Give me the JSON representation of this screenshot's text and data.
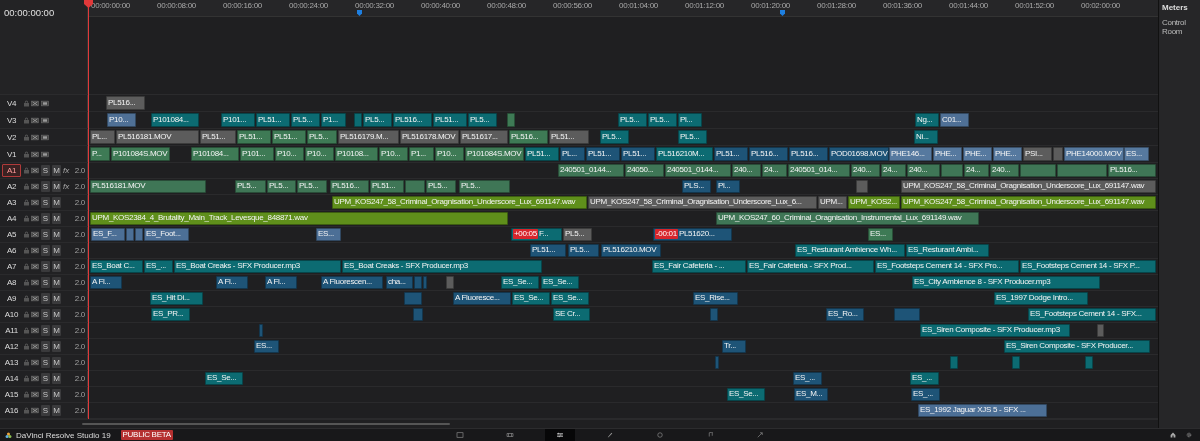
{
  "timecode": "00:00:00:00",
  "ruler": [
    "00:00:00:00",
    "00:00:08:00",
    "00:00:16:00",
    "00:00:24:00",
    "00:00:32:00",
    "00:00:40:00",
    "00:00:48:00",
    "00:00:56:00",
    "00:01:04:00",
    "00:01:12:00",
    "00:01:20:00",
    "00:01:28:00",
    "00:01:36:00",
    "00:01:44:00",
    "00:01:52:00",
    "00:02:00:00"
  ],
  "tracks": [
    {
      "name": "V4",
      "kind": "video",
      "selected": false,
      "clips": [
        {
          "label": "PL516...",
          "color": "#5c5c5c"
        }
      ]
    },
    {
      "name": "V3",
      "kind": "video",
      "selected": false,
      "clips": [
        {
          "label": "P10...",
          "color": "#4f7096"
        },
        {
          "label": "P101084...",
          "color": "#0c6b72"
        },
        {
          "label": "P101...",
          "color": "#0c6b72"
        },
        {
          "label": "PL51...",
          "color": "#0c6b72"
        },
        {
          "label": "PL5...",
          "color": "#0c6b72"
        },
        {
          "label": "P1...",
          "color": "#0c6b72"
        },
        {
          "color": "#0c6b72"
        },
        {
          "label": "PL5...",
          "color": "#0c6b72"
        },
        {
          "label": "PL516...",
          "color": "#0c6b72"
        },
        {
          "label": "PL51...",
          "color": "#0c6b72"
        },
        {
          "label": "PL5...",
          "color": "#0c6b72"
        },
        {
          "color": "#3e7a55"
        },
        {
          "label": "PL5...",
          "color": "#0c6b72"
        },
        {
          "label": "PL5...",
          "color": "#0c6b72"
        },
        {
          "label": "Pl...",
          "color": "#0c6b72"
        },
        {
          "label": "Ng...",
          "color": "#0c6b72"
        },
        {
          "label": "C01...",
          "color": "#4f7096"
        }
      ]
    },
    {
      "name": "V2",
      "kind": "video",
      "selected": false,
      "clips": [
        {
          "label": "PL...",
          "color": "#5c5c5c"
        },
        {
          "label": "PL516181.MOV",
          "color": "#5c5c5c"
        },
        {
          "label": "PL51...",
          "color": "#5c5c5c"
        },
        {
          "label": "PL51...",
          "color": "#3e7a55"
        },
        {
          "label": "PL51...",
          "color": "#3e7a55"
        },
        {
          "label": "PL5...",
          "color": "#3e7a55"
        },
        {
          "label": "PL516179.M...",
          "color": "#5c5c5c"
        },
        {
          "label": "PL516178.MOV",
          "color": "#5c5c5c"
        },
        {
          "label": "PL51617...",
          "color": "#5c5c5c"
        },
        {
          "label": "PL516...",
          "color": "#3e7a55"
        },
        {
          "label": "PL51...",
          "color": "#5c5c5c"
        },
        {
          "label": "PL5...",
          "color": "#0c6b72"
        },
        {
          "label": "PL5...",
          "color": "#0c6b72"
        },
        {
          "label": "Ni...",
          "color": "#0c6b72"
        }
      ]
    },
    {
      "name": "V1",
      "kind": "video",
      "selected": false,
      "clips": [
        {
          "label": "P...",
          "color": "#3e7a55"
        },
        {
          "label": "P101084S.MOV",
          "color": "#3e7a55"
        },
        {
          "label": "P101084...",
          "color": "#3e7a55"
        },
        {
          "label": "P101...",
          "color": "#3e7a55"
        },
        {
          "label": "P10...",
          "color": "#3e7a55"
        },
        {
          "label": "P10...",
          "color": "#3e7a55"
        },
        {
          "label": "P10108...",
          "color": "#3e7a55"
        },
        {
          "label": "P10...",
          "color": "#3e7a55"
        },
        {
          "label": "P1...",
          "color": "#3e7a55"
        },
        {
          "label": "P10...",
          "color": "#3e7a55"
        },
        {
          "label": "P101084S.MOV",
          "color": "#3e7a55"
        },
        {
          "label": "PL51...",
          "color": "#0c6b72"
        },
        {
          "label": "PL...",
          "color": "#1e5477"
        },
        {
          "label": "PL51...",
          "color": "#1e5477"
        },
        {
          "label": "PL51...",
          "color": "#1e5477"
        },
        {
          "label": "PL516210M...",
          "color": "#0c6b72"
        },
        {
          "label": "PL51...",
          "color": "#1e5477"
        },
        {
          "label": "PL516...",
          "color": "#1e5477"
        },
        {
          "label": "PL516...",
          "color": "#1e5477"
        },
        {
          "label": "POD01698.MOV",
          "color": "#1e5477"
        },
        {
          "label": "PHE146...",
          "color": "#56799f"
        },
        {
          "label": "PHE...",
          "color": "#56799f"
        },
        {
          "label": "PHE...",
          "color": "#56799f"
        },
        {
          "label": "PHE...",
          "color": "#56799f"
        },
        {
          "label": "PSI...",
          "color": "#5c5c5c"
        },
        {
          "color": "#5c5c5c"
        },
        {
          "label": "PHE14000.MOV",
          "color": "#56799f"
        },
        {
          "label": "ES...",
          "color": "#56799f"
        }
      ]
    },
    {
      "name": "A1",
      "kind": "audio",
      "selected": true,
      "fx": "fx",
      "solo": "S",
      "mute": "M",
      "format": "2.0",
      "clips": [
        {
          "label": "240501_0144...",
          "color": "#3f7656"
        },
        {
          "label": "24050...",
          "color": "#3f7656"
        },
        {
          "label": "240501_0144...",
          "color": "#3f7656"
        },
        {
          "label": "240...",
          "color": "#3f7656"
        },
        {
          "label": "24...",
          "color": "#3f7656"
        },
        {
          "label": "240501_014...",
          "color": "#3f7656"
        },
        {
          "label": "240...",
          "color": "#3f7656"
        },
        {
          "label": "24...",
          "color": "#3f7656"
        },
        {
          "label": "240...",
          "color": "#3f7656"
        },
        {
          "color": "#3f7656"
        },
        {
          "label": "24...",
          "color": "#3f7656"
        },
        {
          "label": "240...",
          "color": "#3f7656"
        },
        {
          "color": "#3f7656"
        },
        {
          "color": "#3f7656"
        },
        {
          "label": "PL516...",
          "color": "#3f7656"
        }
      ]
    },
    {
      "name": "A2",
      "kind": "audio",
      "selected": false,
      "fx": "fx",
      "solo": "S",
      "mute": "M",
      "format": "2.0",
      "clips": [
        {
          "label": "PL516181.MOV",
          "color": "#3f7656"
        },
        {
          "label": "PL5...",
          "color": "#3f7656"
        },
        {
          "label": "PL5...",
          "color": "#3f7656"
        },
        {
          "label": "PL5...",
          "color": "#3f7656"
        },
        {
          "label": "PL516...",
          "color": "#3f7656"
        },
        {
          "label": "PL51...",
          "color": "#3f7656"
        },
        {
          "color": "#3f7656"
        },
        {
          "label": "PL5...",
          "color": "#3f7656"
        },
        {
          "label": "PL5...",
          "color": "#3f7656"
        },
        {
          "label": "PLS...",
          "color": "#1e5477"
        },
        {
          "label": "Pl...",
          "color": "#1e5477"
        },
        {
          "color": "#5c5c5c"
        },
        {
          "label": "UPM_KOS247_58_Criminal_Oragnisation_Underscore_Lux_691147.wav",
          "color": "#5c5c5c"
        }
      ]
    },
    {
      "name": "A3",
      "kind": "audio",
      "selected": false,
      "solo": "S",
      "mute": "M",
      "format": "2.0",
      "clips": [
        {
          "label": "UPM_KOS247_58_Criminal_Oragnisation_Underscore_Lux_691147.wav",
          "color": "#5f8f1b"
        },
        {
          "label": "UPM_KOS247_58_Criminal_Oragnisation_Underscore_Lux_6...",
          "color": "#5c5c5c"
        },
        {
          "label": "UPM...",
          "color": "#5c5c5c"
        },
        {
          "label": "UPM_KOS2...",
          "color": "#5f8f1b"
        },
        {
          "label": "UPM_KOS247_58_Criminal_Oragnisation_Underscore_Lux_691147.wav",
          "color": "#5f8f1b"
        }
      ]
    },
    {
      "name": "A4",
      "kind": "audio",
      "selected": false,
      "solo": "S",
      "mute": "M",
      "format": "2.0",
      "clips": [
        {
          "label": "UPM_KOS2384_4_Brutality_Main_Track_Levesque_848871.wav",
          "color": "#5f8f1b"
        },
        {
          "label": "UPM_KOS247_60_Criminal_Oragnisation_Instrumental_Lux_691149.wav",
          "color": "#3f7656"
        }
      ]
    },
    {
      "name": "A5",
      "kind": "audio",
      "selected": false,
      "solo": "S",
      "mute": "M",
      "format": "2.0",
      "clips": [
        {
          "label": "ES_F...",
          "color": "#4c6f96"
        },
        {
          "color": "#4c6f96"
        },
        {
          "color": "#4c6f96"
        },
        {
          "label": "ES_Foot...",
          "color": "#4c6f96"
        },
        {
          "label": "ES...",
          "color": "#4c6f96"
        },
        {
          "badge": "+00:05",
          "label": "F...",
          "color": "#0c6b72"
        },
        {
          "label": "PL5...",
          "color": "#5c5c5c"
        },
        {
          "badge": "-00:01",
          "label": "PL51620...",
          "color": "#1e5477"
        },
        {
          "label": "ES...",
          "color": "#3e7a55"
        }
      ]
    },
    {
      "name": "A6",
      "kind": "audio",
      "selected": false,
      "solo": "S",
      "mute": "M",
      "format": "2.0",
      "clips": [
        {
          "label": "PL51...",
          "color": "#1e5477"
        },
        {
          "label": "PL5...",
          "color": "#1e5477"
        },
        {
          "label": "PL516210.MOV",
          "color": "#1e5477"
        },
        {
          "label": "ES_Resturant Ambience Wh...",
          "color": "#0c6b72"
        },
        {
          "label": "ES_Resturant Ambi...",
          "color": "#0c6b72"
        }
      ]
    },
    {
      "name": "A7",
      "kind": "audio",
      "selected": false,
      "solo": "S",
      "mute": "M",
      "format": "2.0",
      "clips": [
        {
          "label": "ES_Boat C...",
          "color": "#0c6b72"
        },
        {
          "label": "ES_...",
          "color": "#0c6b72"
        },
        {
          "label": "ES_Boat Creaks - SFX Producer.mp3",
          "color": "#0c6b72"
        },
        {
          "label": "ES_Boat Creaks - SFX Producer.mp3",
          "color": "#0c6b72"
        },
        {
          "label": "ES_Fair Cafeteria - ...",
          "color": "#0c6b72"
        },
        {
          "label": "ES_Fair Cafeteria - SFX Prod...",
          "color": "#0c6b72"
        },
        {
          "label": "ES_Footsteps Cement 14 - SFX Pro...",
          "color": "#0c6b72"
        },
        {
          "label": "ES_Footsteps Cement 14 - SFX P...",
          "color": "#0c6b72"
        }
      ]
    },
    {
      "name": "A8",
      "kind": "audio",
      "selected": false,
      "solo": "S",
      "mute": "M",
      "format": "2.0",
      "clips": [
        {
          "label": "A Fl...",
          "color": "#1e5477"
        },
        {
          "label": "A Fl...",
          "color": "#1e5477"
        },
        {
          "label": "A Fl...",
          "color": "#1e5477"
        },
        {
          "label": "A Fluorescen...",
          "color": "#1e5477"
        },
        {
          "label": "cha...",
          "color": "#1e5477"
        },
        {
          "color": "#1e5477"
        },
        {
          "color": "#1e5477"
        },
        {
          "color": "#5c5c5c"
        },
        {
          "label": "ES_Se...",
          "color": "#0c6b72"
        },
        {
          "label": "ES_Se...",
          "color": "#0c6b72"
        },
        {
          "label": "ES_City Ambience 8 - SFX Producer.mp3",
          "color": "#0c6b72"
        }
      ]
    },
    {
      "name": "A9",
      "kind": "audio",
      "selected": false,
      "solo": "S",
      "mute": "M",
      "format": "2.0",
      "clips": [
        {
          "label": "ES_Hit Di...",
          "color": "#0c6b72"
        },
        {
          "color": "#1e5477"
        },
        {
          "label": "A Fluoresce...",
          "color": "#1e5477"
        },
        {
          "label": "ES_Se...",
          "color": "#0c6b72"
        },
        {
          "label": "ES_Se...",
          "color": "#0c6b72"
        },
        {
          "label": "ES_Rise...",
          "color": "#1e5477"
        },
        {
          "label": "ES_1997 Dodge Intro...",
          "color": "#0c6b72"
        }
      ]
    },
    {
      "name": "A10",
      "kind": "audio",
      "selected": false,
      "solo": "S",
      "mute": "M",
      "format": "2.0",
      "clips": [
        {
          "label": "ES_PR...",
          "color": "#0c6b72"
        },
        {
          "color": "#1e5477"
        },
        {
          "label": "SE Cr...",
          "color": "#0c6b72"
        },
        {
          "color": "#1e5477"
        },
        {
          "label": "ES_Ro...",
          "color": "#1e5477"
        },
        {
          "color": "#1e5477"
        },
        {
          "label": "ES_Footsteps Cement 14 - SFX...",
          "color": "#0c6b72"
        }
      ]
    },
    {
      "name": "A11",
      "kind": "audio",
      "selected": false,
      "solo": "S",
      "mute": "M",
      "format": "2.0",
      "clips": [
        {
          "color": "#1e5477"
        },
        {
          "label": "ES_Siren Composite - SFX Producer.mp3",
          "color": "#0c6b72"
        },
        {
          "color": "#5c5c5c"
        }
      ]
    },
    {
      "name": "A12",
      "kind": "audio",
      "selected": false,
      "solo": "S",
      "mute": "M",
      "format": "2.0",
      "clips": [
        {
          "label": "ES...",
          "color": "#1e5477"
        },
        {
          "label": "Tr...",
          "color": "#1e5477"
        },
        {
          "label": "ES_Siren Composite - SFX Producer...",
          "color": "#0c6b72"
        }
      ]
    },
    {
      "name": "A13",
      "kind": "audio",
      "selected": false,
      "solo": "S",
      "mute": "M",
      "format": "2.0",
      "clips": [
        {
          "color": "#1e5477"
        },
        {
          "color": "#0c6b72"
        },
        {
          "color": "#0c6b72"
        },
        {
          "color": "#0c6b72"
        }
      ]
    },
    {
      "name": "A14",
      "kind": "audio",
      "selected": false,
      "solo": "S",
      "mute": "M",
      "format": "2.0",
      "clips": [
        {
          "label": "ES_Se...",
          "color": "#0c6b72"
        },
        {
          "label": "ES_...",
          "color": "#1e5477"
        },
        {
          "label": "ES_...",
          "color": "#0c6b72"
        }
      ]
    },
    {
      "name": "A15",
      "kind": "audio",
      "selected": false,
      "solo": "S",
      "mute": "M",
      "format": "2.0",
      "clips": [
        {
          "label": "ES_Se...",
          "color": "#0c6b72"
        },
        {
          "label": "ES_M...",
          "color": "#1e5477"
        },
        {
          "label": "ES_...",
          "color": "#1e5477"
        }
      ]
    },
    {
      "name": "A16",
      "kind": "audio",
      "selected": false,
      "solo": "S",
      "mute": "M",
      "format": "2.0",
      "clips": [
        {
          "label": "ES_1992 Jaguar XJS 5 - SFX ...",
          "color": "#4c6f96"
        }
      ]
    }
  ],
  "meters": {
    "title": "Meters",
    "subtitle": "Control Room"
  },
  "app": {
    "name": "DaVinci Resolve Studio 19",
    "badge": "PUBLIC BETA"
  },
  "pages": [
    {
      "selected": false
    },
    {
      "selected": false
    },
    {
      "selected": true
    },
    {
      "selected": false
    },
    {
      "selected": false
    },
    {
      "selected": false
    },
    {
      "selected": false
    }
  ]
}
